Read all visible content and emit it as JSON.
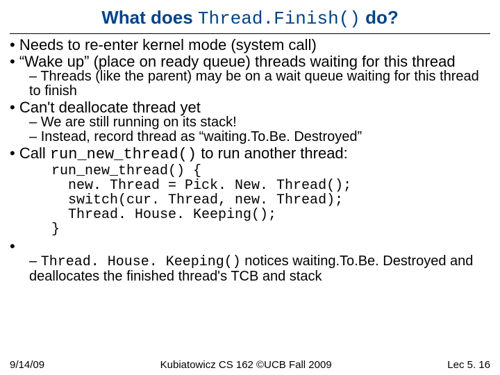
{
  "title_prefix": "What does ",
  "title_code": "Thread.Finish()",
  "title_suffix": " do?",
  "bullets": [
    "Needs to re-enter kernel mode (system call)",
    "“Wake up” (place on ready queue) threads waiting for this thread"
  ],
  "sub1": "Threads (like the parent) may be on a wait queue waiting for this thread to finish",
  "b3": "Can't deallocate thread yet",
  "sub3a": "We are still running on its stack!",
  "sub3b": "Instead, record thread as “waiting.To.Be. Destroyed”",
  "b4_pre": "Call ",
  "b4_code": "run_new_thread()",
  "b4_post": " to run another thread:",
  "code": "run_new_thread() {\n  new. Thread = Pick. New. Thread();\n  switch(cur. Thread, new. Thread);\n  Thread. House. Keeping();\n}",
  "sub4_code": "Thread. House. Keeping()",
  "sub4_post": " notices waiting.To.Be. Destroyed and deallocates the finished thread's TCB and stack",
  "footer_left": "9/14/09",
  "footer_center": "Kubiatowicz CS 162 ©UCB Fall 2009",
  "footer_right": "Lec 5. 16"
}
